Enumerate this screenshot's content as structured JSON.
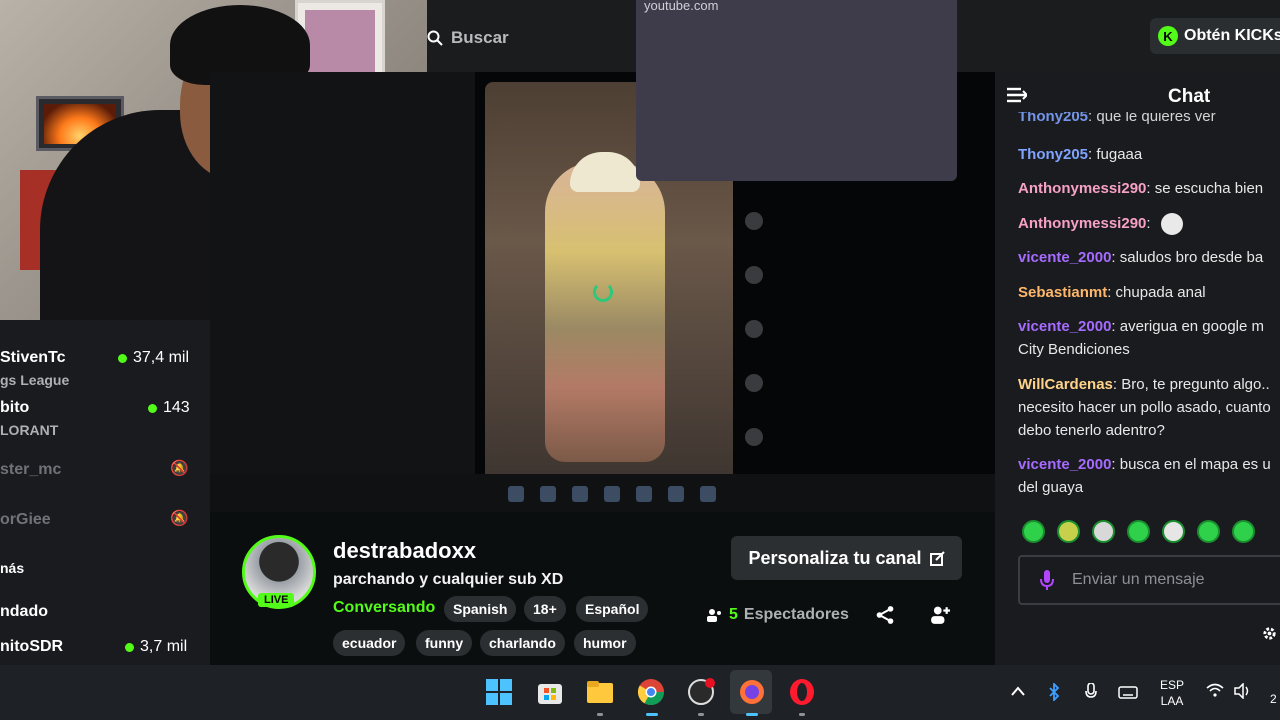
{
  "browser": {
    "search_placeholder": "Buscar",
    "popup_url": "youtube.com",
    "kicks_label": "Obtén KICKs",
    "kicks_icon": "kick-logo"
  },
  "player": {
    "loading_icon": "spinner-icon"
  },
  "sidebar": {
    "items": [
      {
        "name": "StivenTc",
        "sub": "gs League",
        "count": "37,4 mil",
        "live": true
      },
      {
        "name": "bito",
        "sub": "LORANT",
        "count": "143",
        "live": true
      },
      {
        "name": "ster_mc",
        "sub": "",
        "count": "",
        "live": false
      },
      {
        "name": "orGiee",
        "sub": "",
        "count": "",
        "live": false
      },
      {
        "name": "nitoSDR",
        "sub": "",
        "count": "3,7 mil",
        "live": true
      }
    ],
    "more_label": "nás",
    "section_label": "ndado"
  },
  "channel": {
    "name": "destrabadoxx",
    "title": "parchando y cualquier sub XD",
    "category": "Conversando",
    "live_badge": "LIVE",
    "tags_row1": [
      "Spanish",
      "18+",
      "Español"
    ],
    "tags_row2": [
      "ecuador",
      "funny",
      "charlando",
      "humor"
    ],
    "customize_label": "Personaliza tu canal",
    "viewers_count": "5",
    "viewers_label": "Espectadores"
  },
  "chat": {
    "title": "Chat",
    "partial_top": {
      "user": "Thony205",
      "text": ": que le quieres ver"
    },
    "messages": [
      {
        "user": "Thony205",
        "text": ": fugaaa",
        "color": "#7fa3ff"
      },
      {
        "user": "Anthonymessi290",
        "text": ": se escucha bien",
        "color": "#f7a1c4"
      },
      {
        "user": "Anthonymessi290",
        "text": ":",
        "color": "#f7a1c4"
      },
      {
        "user": "vicente_2000",
        "text": ": saludos bro desde ba",
        "color": "#a66bff"
      },
      {
        "user": "Sebastianmt",
        "text": ": chupada anal",
        "color": "#ffb86b"
      },
      {
        "user": "vicente_2000",
        "text": ": averigua en google m",
        "line2": "City Bendiciones",
        "color": "#a66bff"
      },
      {
        "user": "WillCardenas",
        "text": ": Bro, te pregunto algo..",
        "line2": "necesito hacer un pollo asado, cuanto",
        "line3": "debo tenerlo adentro?",
        "color": "#ffd48a"
      },
      {
        "user": "vicente_2000",
        "text": ": busca en el mapa es u",
        "line2": "del guaya",
        "color": "#a66bff"
      }
    ],
    "input_placeholder": "Enviar un mensaje"
  },
  "taskbar": {
    "lang_line1": "ESP",
    "lang_line2": "LAA",
    "clock_partial": "2"
  }
}
